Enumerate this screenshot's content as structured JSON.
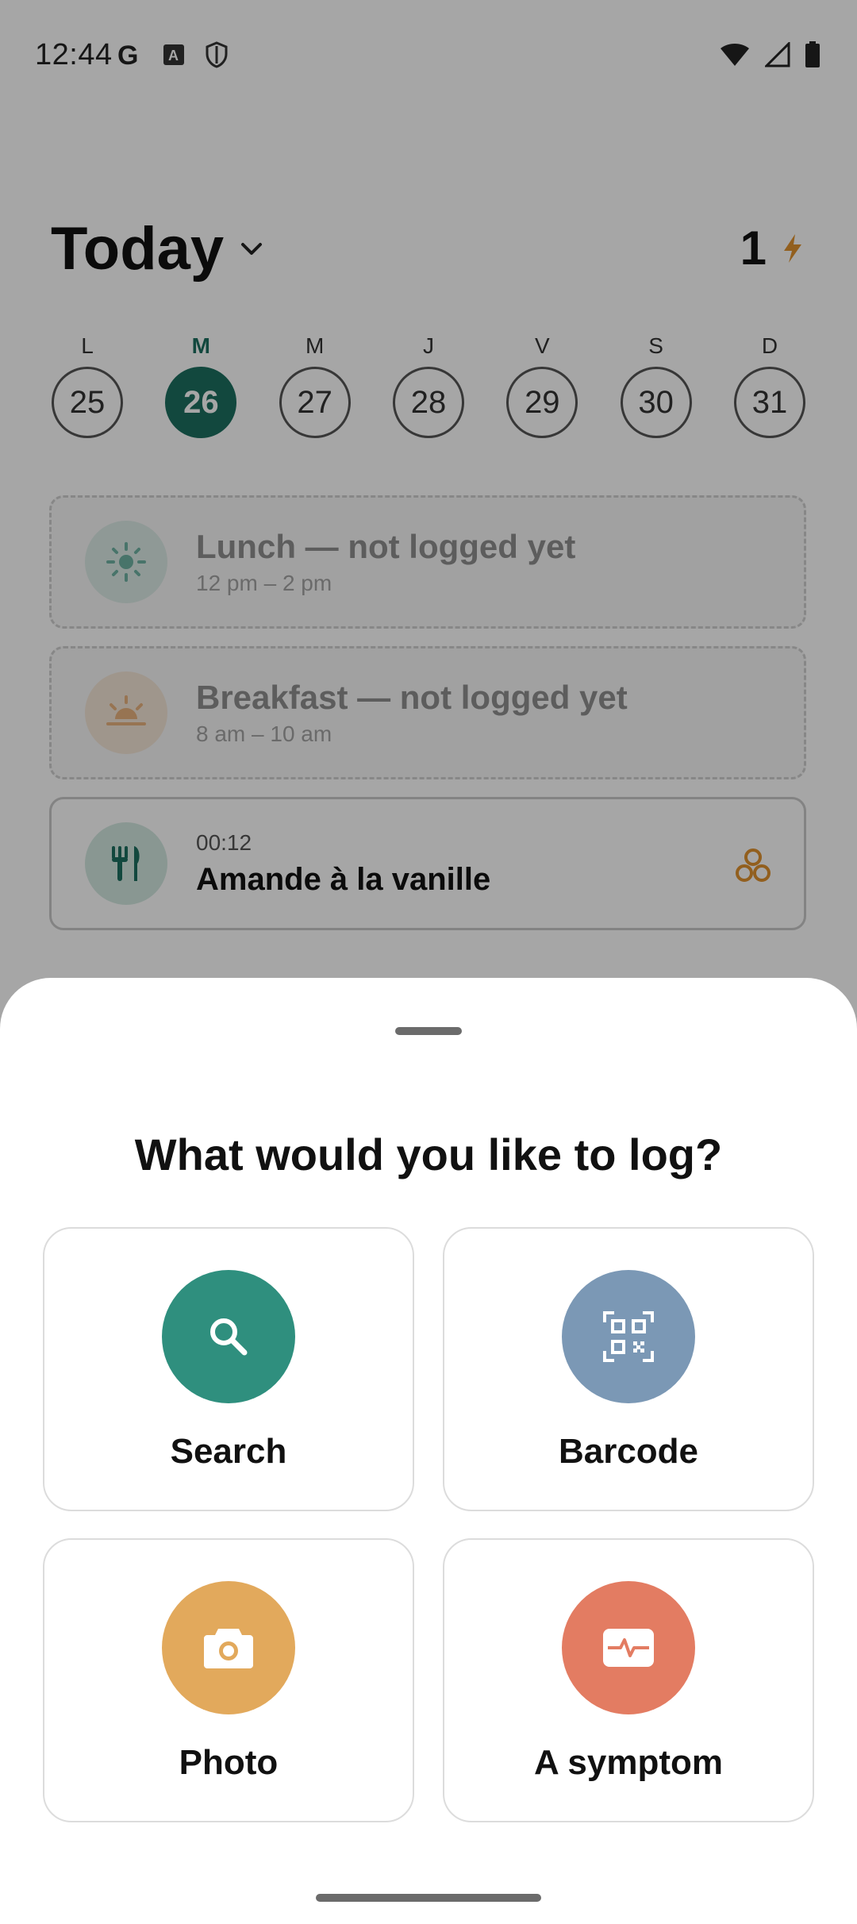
{
  "status_bar": {
    "time": "12:44",
    "left_icons": [
      "google-icon",
      "font-icon",
      "shield-icon"
    ],
    "right_icons": [
      "wifi-icon",
      "signal-icon",
      "battery-icon"
    ]
  },
  "header": {
    "title": "Today",
    "streak_count": "1"
  },
  "week": {
    "days": [
      {
        "letter": "L",
        "date": "25",
        "active": false
      },
      {
        "letter": "M",
        "date": "26",
        "active": true
      },
      {
        "letter": "M",
        "date": "27",
        "active": false
      },
      {
        "letter": "J",
        "date": "28",
        "active": false
      },
      {
        "letter": "V",
        "date": "29",
        "active": false
      },
      {
        "letter": "S",
        "date": "30",
        "active": false
      },
      {
        "letter": "D",
        "date": "31",
        "active": false
      }
    ]
  },
  "meals": [
    {
      "title": "Lunch — not logged yet",
      "subtitle": "12 pm – 2 pm",
      "icon": "sun-icon"
    },
    {
      "title": "Breakfast — not logged yet",
      "subtitle": "8 am – 10 am",
      "icon": "sunrise-icon"
    },
    {
      "time": "00:12",
      "title": "Amande à la vanille",
      "icon": "fork-knife-icon",
      "extra_icon": "ingredients-icon"
    }
  ],
  "sheet": {
    "title": "What would you like to log?",
    "options": [
      {
        "label": "Search",
        "icon": "search-icon",
        "color": "#2f8f7e"
      },
      {
        "label": "Barcode",
        "icon": "qr-code-icon",
        "color": "#7b98b5"
      },
      {
        "label": "Photo",
        "icon": "camera-icon",
        "color": "#e2a95c"
      },
      {
        "label": "A symptom",
        "icon": "pulse-icon",
        "color": "#e37c62"
      }
    ]
  },
  "colors": {
    "accent": "#1d6f60",
    "streak": "#e0922f"
  }
}
